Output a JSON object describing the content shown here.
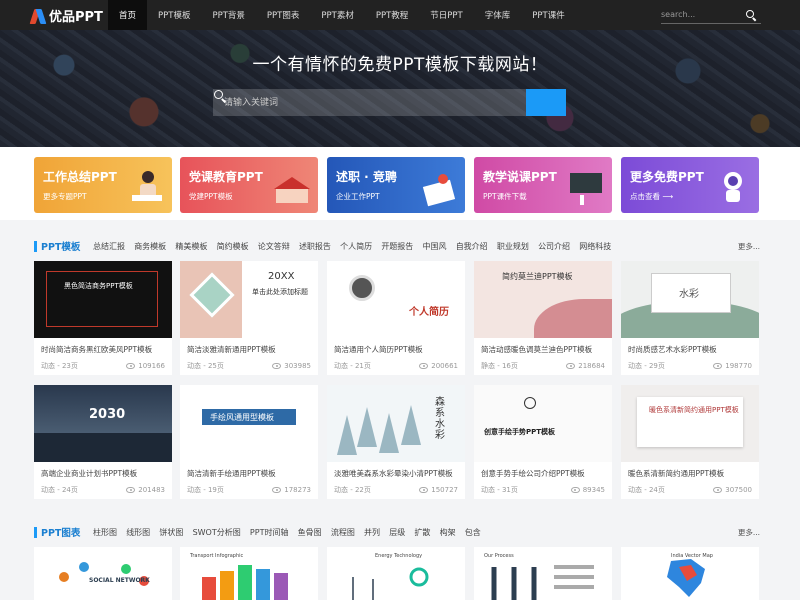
{
  "nav": {
    "logo_text": "优品PPT",
    "links": [
      "首页",
      "PPT模板",
      "PPT背景",
      "PPT图表",
      "PPT素材",
      "PPT教程",
      "节日PPT",
      "字体库",
      "PPT课件"
    ],
    "search_placeholder": "search..."
  },
  "hero": {
    "title": "一个有情怀的免费PPT模板下载网站！",
    "search_placeholder": "请输入关键词"
  },
  "categories": [
    {
      "title": "工作总结PPT",
      "sub": "更多专题PPT"
    },
    {
      "title": "党课教育PPT",
      "sub": "党建PPT模板"
    },
    {
      "title": "述职 · 竞聘",
      "sub": "企业工作PPT"
    },
    {
      "title": "教学说课PPT",
      "sub": "PPT课件下载"
    },
    {
      "title": "更多免费PPT",
      "sub": "点击查看 ⟶"
    }
  ],
  "template_section": {
    "title": "PPT模板",
    "tags": [
      "总结汇报",
      "商务模板",
      "精美模板",
      "简约模板",
      "论文答辩",
      "述职报告",
      "个人简历",
      "开题报告",
      "中国风",
      "自我介绍",
      "职业规划",
      "公司介绍",
      "网络科技"
    ],
    "more": "更多..."
  },
  "templates": [
    {
      "title": "时尚简洁商务黑红欧美风PPT模板",
      "meta": "动态 - 23页",
      "views": "109166",
      "thumb_text": "黑色简洁商务PPT模板"
    },
    {
      "title": "简洁淡雅清新通用PPT模板",
      "meta": "动态 - 25页",
      "views": "303985",
      "thumb_text": "20XX",
      "thumb_text2": "单击此处添加标题"
    },
    {
      "title": "简洁通用个人简历PPT模板",
      "meta": "动态 - 21页",
      "views": "200661",
      "thumb_text": "个人简历"
    },
    {
      "title": "简洁动感暖色调莫兰迪色PPT模板",
      "meta": "静态 - 16页",
      "views": "218684",
      "thumb_text": "简约莫兰迪PPT模板"
    },
    {
      "title": "时尚质感艺术水彩PPT模板",
      "meta": "动态 - 29页",
      "views": "198770",
      "thumb_text": "水彩"
    },
    {
      "title": "高端企业商业计划书PPT模板",
      "meta": "动态 - 24页",
      "views": "201483",
      "thumb_text": "2030"
    },
    {
      "title": "简洁清新手绘通用PPT模板",
      "meta": "动态 - 19页",
      "views": "178273",
      "thumb_text": "手绘风通用型模板"
    },
    {
      "title": "淡雅唯美森系水彩晕染小清PPT模板",
      "meta": "动态 - 22页",
      "views": "150727",
      "thumb_text": "森系水彩"
    },
    {
      "title": "创意手势手绘公司介绍PPT模板",
      "meta": "动态 - 31页",
      "views": "89345",
      "thumb_text": "创意手绘手势PPT模板"
    },
    {
      "title": "暖色系清新简约通用PPT模板",
      "meta": "动态 - 24页",
      "views": "307500",
      "thumb_text": "暖色系清新简约通用PPT模板"
    }
  ],
  "chart_section": {
    "title": "PPT图表",
    "tags": [
      "柱形图",
      "线形图",
      "饼状图",
      "SWOT分析图",
      "PPT时间轴",
      "鱼骨图",
      "流程图",
      "并列",
      "层级",
      "扩散",
      "构架",
      "包含"
    ],
    "more": "更多..."
  },
  "chart_thumbs": [
    "SOCIAL NETWORK",
    "Transport Infographic",
    "Energy Technology",
    "Our Process",
    "India Vector Map"
  ]
}
